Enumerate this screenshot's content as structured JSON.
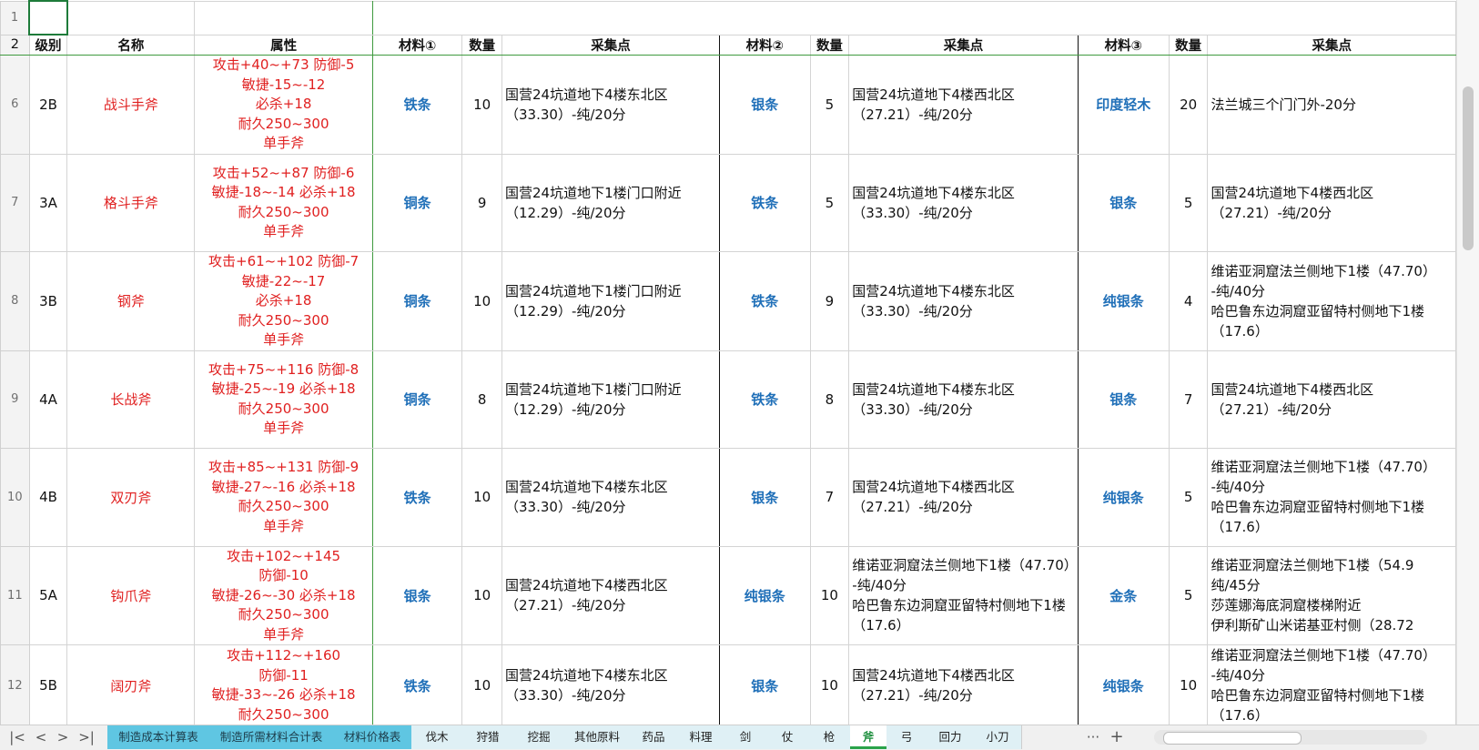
{
  "headers": {
    "level": "级别",
    "name": "名称",
    "attr": "属性",
    "mat1": "材料①",
    "mat2": "材料②",
    "mat3": "材料③",
    "qty": "数量",
    "loc": "采集点"
  },
  "row_numbers": {
    "r1": "1",
    "r2": "2"
  },
  "rows": [
    {
      "num": "6",
      "level": "2B",
      "name": "战斗手斧",
      "attr": [
        "攻击+40~+73 防御-5",
        "敏捷-15~-12",
        "必杀+18",
        "耐久250~300",
        "单手斧"
      ],
      "mat1": "铁条",
      "qty1": "10",
      "loc1": [
        "国营24坑道地下4楼东北区",
        "（33.30）-纯/20分"
      ],
      "mat2": "银条",
      "qty2": "5",
      "loc2": [
        "国营24坑道地下4楼西北区",
        "（27.21）-纯/20分"
      ],
      "mat3": "印度轻木",
      "qty3": "20",
      "loc3": [
        "法兰城三个门门外-20分"
      ]
    },
    {
      "num": "7",
      "level": "3A",
      "name": "格斗手斧",
      "attr": [
        "攻击+52~+87 防御-6",
        "敏捷-18~-14 必杀+18",
        "耐久250~300",
        "单手斧"
      ],
      "mat1": "铜条",
      "qty1": "9",
      "loc1": [
        "国营24坑道地下1楼门口附近",
        "（12.29）-纯/20分"
      ],
      "mat2": "铁条",
      "qty2": "5",
      "loc2": [
        "国营24坑道地下4楼东北区",
        "（33.30）-纯/20分"
      ],
      "mat3": "银条",
      "qty3": "5",
      "loc3": [
        "国营24坑道地下4楼西北区",
        "（27.21）-纯/20分"
      ]
    },
    {
      "num": "8",
      "level": "3B",
      "name": "钢斧",
      "attr": [
        "攻击+61~+102 防御-7",
        "敏捷-22~-17",
        "必杀+18",
        "耐久250~300",
        "单手斧"
      ],
      "mat1": "铜条",
      "qty1": "10",
      "loc1": [
        "国营24坑道地下1楼门口附近",
        "（12.29）-纯/20分"
      ],
      "mat2": "铁条",
      "qty2": "9",
      "loc2": [
        "国营24坑道地下4楼东北区",
        "（33.30）-纯/20分"
      ],
      "mat3": "纯银条",
      "qty3": "4",
      "loc3": [
        "维诺亚洞窟法兰侧地下1楼（47.70）",
        "-纯/40分",
        "哈巴鲁东边洞窟亚留特村侧地下1楼",
        "（17.6）"
      ]
    },
    {
      "num": "9",
      "level": "4A",
      "name": "长战斧",
      "attr": [
        "攻击+75~+116 防御-8",
        "敏捷-25~-19 必杀+18",
        "耐久250~300",
        "单手斧"
      ],
      "mat1": "铜条",
      "qty1": "8",
      "loc1": [
        "国营24坑道地下1楼门口附近",
        "（12.29）-纯/20分"
      ],
      "mat2": "铁条",
      "qty2": "8",
      "loc2": [
        "国营24坑道地下4楼东北区",
        "（33.30）-纯/20分"
      ],
      "mat3": "银条",
      "qty3": "7",
      "loc3": [
        "国营24坑道地下4楼西北区",
        "（27.21）-纯/20分"
      ]
    },
    {
      "num": "10",
      "level": "4B",
      "name": "双刃斧",
      "attr": [
        "攻击+85~+131 防御-9",
        "敏捷-27~-16 必杀+18",
        "耐久250~300",
        "单手斧"
      ],
      "mat1": "铁条",
      "qty1": "10",
      "loc1": [
        "国营24坑道地下4楼东北区",
        "（33.30）-纯/20分"
      ],
      "mat2": "银条",
      "qty2": "7",
      "loc2": [
        "国营24坑道地下4楼西北区",
        "（27.21）-纯/20分"
      ],
      "mat3": "纯银条",
      "qty3": "5",
      "loc3": [
        "维诺亚洞窟法兰侧地下1楼（47.70）",
        "-纯/40分",
        "哈巴鲁东边洞窟亚留特村侧地下1楼",
        "（17.6）"
      ]
    },
    {
      "num": "11",
      "level": "5A",
      "name": "钩爪斧",
      "attr": [
        "攻击+102~+145",
        "防御-10",
        "敏捷-26~-30 必杀+18",
        "耐久250~300",
        "单手斧"
      ],
      "mat1": "银条",
      "qty1": "10",
      "loc1": [
        "国营24坑道地下4楼西北区",
        "（27.21）-纯/20分"
      ],
      "mat2": "纯银条",
      "qty2": "10",
      "loc2": [
        "维诺亚洞窟法兰侧地下1楼（47.70）",
        "-纯/40分",
        "哈巴鲁东边洞窟亚留特村侧地下1楼",
        "（17.6）"
      ],
      "mat3": "金条",
      "qty3": "5",
      "loc3": [
        "维诺亚洞窟法兰侧地下1楼（54.9",
        "纯/45分",
        "莎莲娜海底洞窟楼梯附近",
        "伊利斯矿山米诺基亚村侧（28.72"
      ]
    },
    {
      "num": "12",
      "level": "5B",
      "name": "阔刃斧",
      "attr": [
        "攻击+112~+160",
        "防御-11",
        "敏捷-33~-26 必杀+18",
        "耐久250~300"
      ],
      "mat1": "铁条",
      "qty1": "10",
      "loc1": [
        "国营24坑道地下4楼东北区",
        "（33.30）-纯/20分"
      ],
      "mat2": "银条",
      "qty2": "10",
      "loc2": [
        "国营24坑道地下4楼西北区",
        "（27.21）-纯/20分"
      ],
      "mat3": "纯银条",
      "qty3": "10",
      "loc3": [
        "维诺亚洞窟法兰侧地下1楼（47.70）",
        "-纯/40分",
        "哈巴鲁东边洞窟亚留特村侧地下1楼",
        "（17.6）"
      ]
    }
  ],
  "tabs": [
    {
      "label": "制造成本计算表",
      "style": "hl"
    },
    {
      "label": "制造所需材料合计表",
      "style": "hl"
    },
    {
      "label": "材料价格表",
      "style": "hl"
    },
    {
      "label": "伐木",
      "style": "pl"
    },
    {
      "label": "狩猎",
      "style": "pl"
    },
    {
      "label": "挖掘",
      "style": "pl"
    },
    {
      "label": "其他原料",
      "style": "pl"
    },
    {
      "label": "药品",
      "style": "pl"
    },
    {
      "label": "料理",
      "style": "pl"
    },
    {
      "label": "剑",
      "style": "pl"
    },
    {
      "label": "仗",
      "style": "pl"
    },
    {
      "label": "枪",
      "style": "pl"
    },
    {
      "label": "斧",
      "style": "active"
    },
    {
      "label": "弓",
      "style": "pl"
    },
    {
      "label": "回力",
      "style": "pl"
    },
    {
      "label": "小刀",
      "style": "pl"
    }
  ],
  "nav": {
    "first": "|<",
    "prev": "<",
    "next": ">",
    "last": ">|",
    "more": "···",
    "add": "+"
  },
  "colors": {
    "attr_red": "#e02020",
    "material_blue": "#1f6fb8",
    "active_tab_green": "#2aa34a",
    "tab_highlight": "#5fc6e2"
  }
}
